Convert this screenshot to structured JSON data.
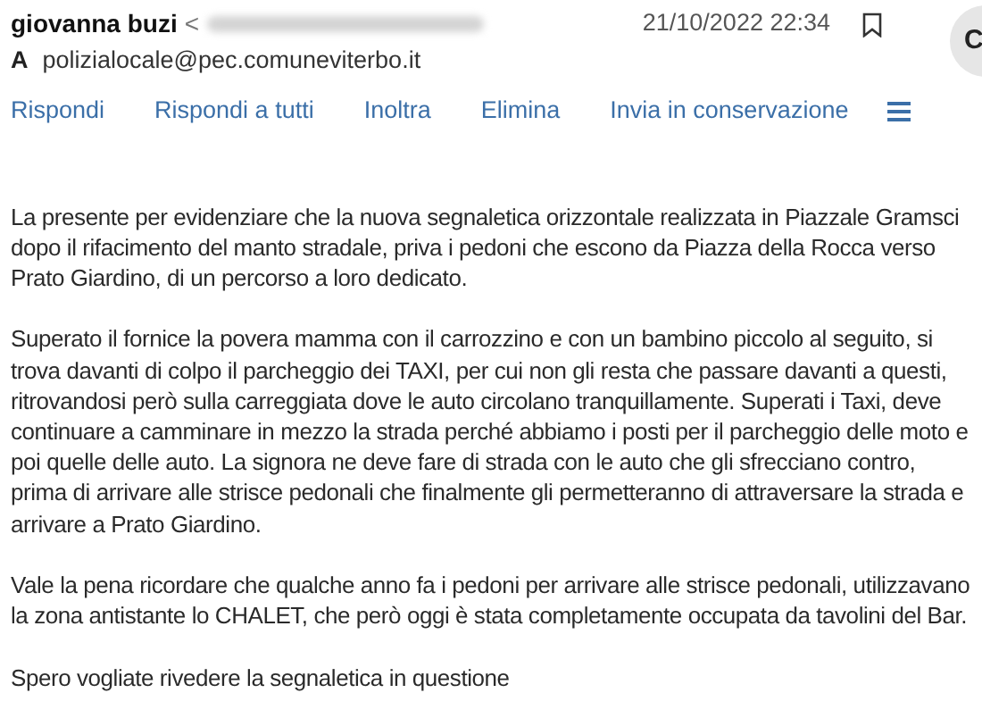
{
  "message": {
    "sender": "giovanna buzi",
    "sender_open": "<",
    "date": "21/10/2022 22:34",
    "to_label": "A",
    "to": "polizialocale@pec.comuneviterbo.it",
    "avatar_letter": "C"
  },
  "actions": [
    "Rispondi",
    "Rispondi a tutti",
    "Inoltra",
    "Elimina",
    "Invia in conservazione"
  ],
  "body": [
    "La presente per evidenziare che la nuova segnaletica orizzontale realizzata in Piazzale Gramsci dopo il rifacimento del manto stradale, priva i pedoni che escono da Piazza della Rocca verso Prato Giardino, di un percorso a loro dedicato.",
    "Superato il fornice la povera mamma con il carrozzino e con un bambino piccolo al seguito, si trova davanti di colpo il parcheggio dei TAXI, per cui non gli resta che passare davanti a questi, ritrovandosi però sulla carreggiata dove le auto circolano tranquillamente. Superati i Taxi, deve continuare a camminare in mezzo la strada perché abbiamo i posti per il parcheggio delle moto e poi quelle delle auto. La signora ne deve fare di strada con le auto che gli sfrecciano contro, prima di arrivare alle strisce pedonali che finalmente gli permetteranno di attraversare la strada e arrivare a Prato Giardino.",
    "Vale la pena ricordare che qualche anno fa i pedoni per arrivare alle strisce pedonali, utilizzavano la zona antistante lo CHALET, che però oggi è stata completamente occupata da tavolini del Bar.",
    "Spero vogliate rivedere la segnaletica in questione"
  ]
}
